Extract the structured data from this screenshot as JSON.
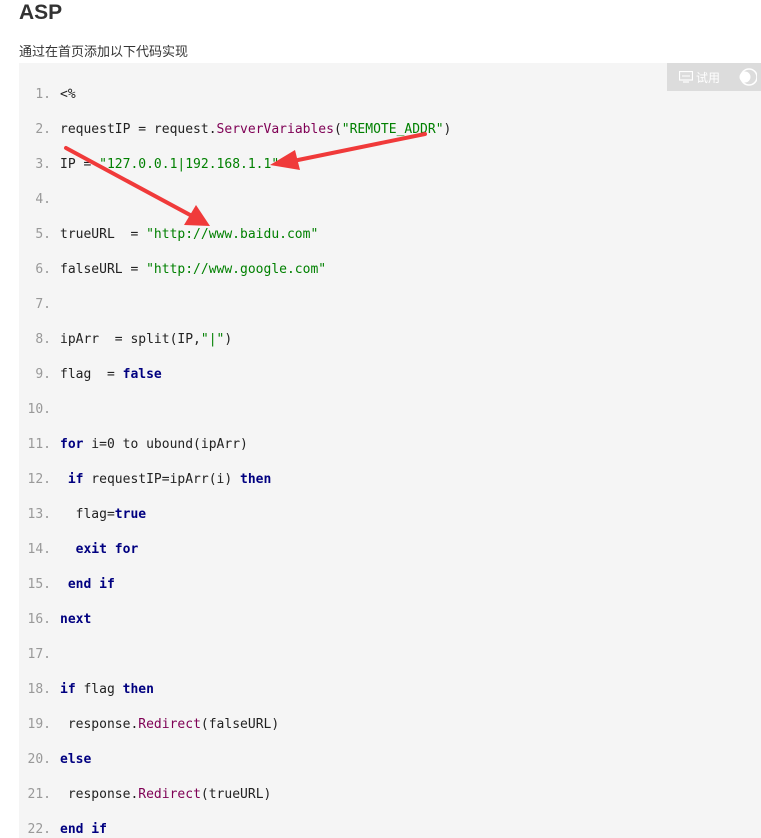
{
  "heading": "ASP",
  "intro": "通过在首页添加以下代码实现",
  "toolbar": {
    "try_label": "试用"
  },
  "colors": {
    "code_bg": "#f5f5f5",
    "arrow": "#f03a3a",
    "keyword": "#000080",
    "string": "#008000",
    "function": "#7f0055"
  },
  "icons": {
    "try": "monitor-icon",
    "toggle": "toggle-icon",
    "annotation": "red-arrow-icon"
  },
  "code": {
    "lines": [
      {
        "num": "1.",
        "tokens": [
          {
            "t": "plain",
            "v": "<%"
          }
        ]
      },
      {
        "num": "2.",
        "tokens": [
          {
            "t": "plain",
            "v": "requestIP = request."
          },
          {
            "t": "fn",
            "v": "ServerVariables"
          },
          {
            "t": "plain",
            "v": "("
          },
          {
            "t": "str",
            "v": "\"REMOTE_ADDR\""
          },
          {
            "t": "plain",
            "v": ")"
          }
        ]
      },
      {
        "num": "3.",
        "tokens": [
          {
            "t": "plain",
            "v": "IP = "
          },
          {
            "t": "str",
            "v": "\"127.0.0.1|192.168.1.1\""
          }
        ]
      },
      {
        "num": "4.",
        "tokens": []
      },
      {
        "num": "5.",
        "tokens": [
          {
            "t": "plain",
            "v": "trueURL  = "
          },
          {
            "t": "str",
            "v": "\"http://www.baidu.com\""
          }
        ]
      },
      {
        "num": "6.",
        "tokens": [
          {
            "t": "plain",
            "v": "falseURL = "
          },
          {
            "t": "str",
            "v": "\"http://www.google.com\""
          }
        ]
      },
      {
        "num": "7.",
        "tokens": []
      },
      {
        "num": "8.",
        "tokens": [
          {
            "t": "plain",
            "v": "ipArr  = split(IP,"
          },
          {
            "t": "str",
            "v": "\"|\""
          },
          {
            "t": "plain",
            "v": ")"
          }
        ]
      },
      {
        "num": "9.",
        "tokens": [
          {
            "t": "plain",
            "v": "flag  = "
          },
          {
            "t": "kw",
            "v": "false"
          }
        ]
      },
      {
        "num": "10.",
        "tokens": []
      },
      {
        "num": "11.",
        "tokens": [
          {
            "t": "kw",
            "v": "for"
          },
          {
            "t": "plain",
            "v": " i=0 to ubound(ipArr)"
          }
        ]
      },
      {
        "num": "12.",
        "tokens": [
          {
            "t": "plain",
            "v": " "
          },
          {
            "t": "kw",
            "v": "if"
          },
          {
            "t": "plain",
            "v": " requestIP=ipArr(i) "
          },
          {
            "t": "kw",
            "v": "then"
          }
        ]
      },
      {
        "num": "13.",
        "tokens": [
          {
            "t": "plain",
            "v": "  flag="
          },
          {
            "t": "kw",
            "v": "true"
          }
        ]
      },
      {
        "num": "14.",
        "tokens": [
          {
            "t": "plain",
            "v": "  "
          },
          {
            "t": "kw",
            "v": "exit for"
          }
        ]
      },
      {
        "num": "15.",
        "tokens": [
          {
            "t": "plain",
            "v": " "
          },
          {
            "t": "kw",
            "v": "end if"
          }
        ]
      },
      {
        "num": "16.",
        "tokens": [
          {
            "t": "kw",
            "v": "next"
          }
        ]
      },
      {
        "num": "17.",
        "tokens": []
      },
      {
        "num": "18.",
        "tokens": [
          {
            "t": "kw",
            "v": "if"
          },
          {
            "t": "plain",
            "v": " flag "
          },
          {
            "t": "kw",
            "v": "then"
          }
        ]
      },
      {
        "num": "19.",
        "tokens": [
          {
            "t": "plain",
            "v": " response."
          },
          {
            "t": "fn",
            "v": "Redirect"
          },
          {
            "t": "plain",
            "v": "(falseURL)"
          }
        ]
      },
      {
        "num": "20.",
        "tokens": [
          {
            "t": "kw",
            "v": "else"
          }
        ]
      },
      {
        "num": "21.",
        "tokens": [
          {
            "t": "plain",
            "v": " response."
          },
          {
            "t": "fn",
            "v": "Redirect"
          },
          {
            "t": "plain",
            "v": "(trueURL)"
          }
        ]
      },
      {
        "num": "22.",
        "tokens": [
          {
            "t": "kw",
            "v": "end if"
          }
        ]
      }
    ]
  }
}
